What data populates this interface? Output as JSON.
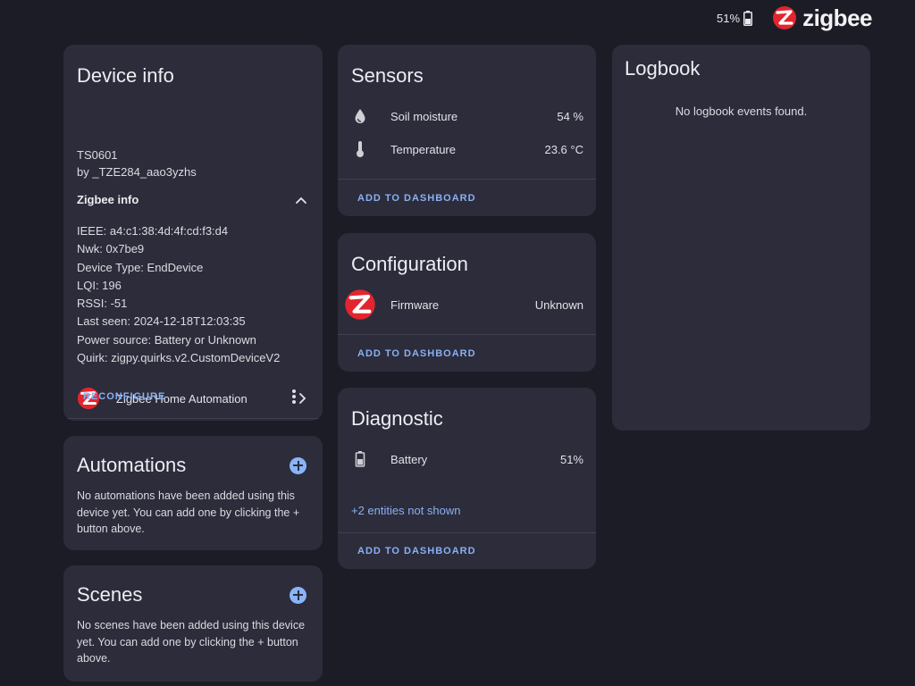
{
  "topbar": {
    "battery_percent": "51%",
    "brand_word": "zigbee"
  },
  "colors": {
    "background": "#1c1c26",
    "card": "#2c2c3b",
    "accent": "#8ab4f8",
    "brand_red": "#e2252f"
  },
  "device_info": {
    "title": "Device info",
    "model": "TS0601",
    "manufacturer": "by _TZE284_aao3yzhs",
    "zigbee_info_label": "Zigbee info",
    "zigbee_info_lines": [
      "IEEE: a4:c1:38:4d:4f:cd:f3:d4",
      "Nwk: 0x7be9",
      "Device Type: EndDevice",
      "LQI: 196",
      "RSSI: -51",
      "Last seen: 2024-12-18T12:03:35",
      "Power source: Battery or Unknown",
      "Quirk: zigpy.quirks.v2.CustomDeviceV2"
    ],
    "integration_label": "Zigbee Home Automation",
    "reconfigure_label": "RECONFIGURE"
  },
  "automations": {
    "title": "Automations",
    "empty_text": "No automations have been added using this device yet. You can add one by clicking the + button above."
  },
  "scenes": {
    "title": "Scenes",
    "empty_text": "No scenes have been added using this device yet. You can add one by clicking the + button above."
  },
  "sensors": {
    "title": "Sensors",
    "items": [
      {
        "icon": "water-drop-icon",
        "name": "Soil moisture",
        "value": "54 %"
      },
      {
        "icon": "thermometer-icon",
        "name": "Temperature",
        "value": "23.6 °C"
      }
    ],
    "add_label": "ADD TO DASHBOARD"
  },
  "configuration": {
    "title": "Configuration",
    "items": [
      {
        "icon": "zigbee-logo-icon",
        "name": "Firmware",
        "value": "Unknown"
      }
    ],
    "add_label": "ADD TO DASHBOARD"
  },
  "diagnostic": {
    "title": "Diagnostic",
    "items": [
      {
        "icon": "battery-icon",
        "name": "Battery",
        "value": "51%"
      }
    ],
    "more_label": "+2 entities not shown",
    "add_label": "ADD TO DASHBOARD"
  },
  "logbook": {
    "title": "Logbook",
    "empty_text": "No logbook events found."
  }
}
